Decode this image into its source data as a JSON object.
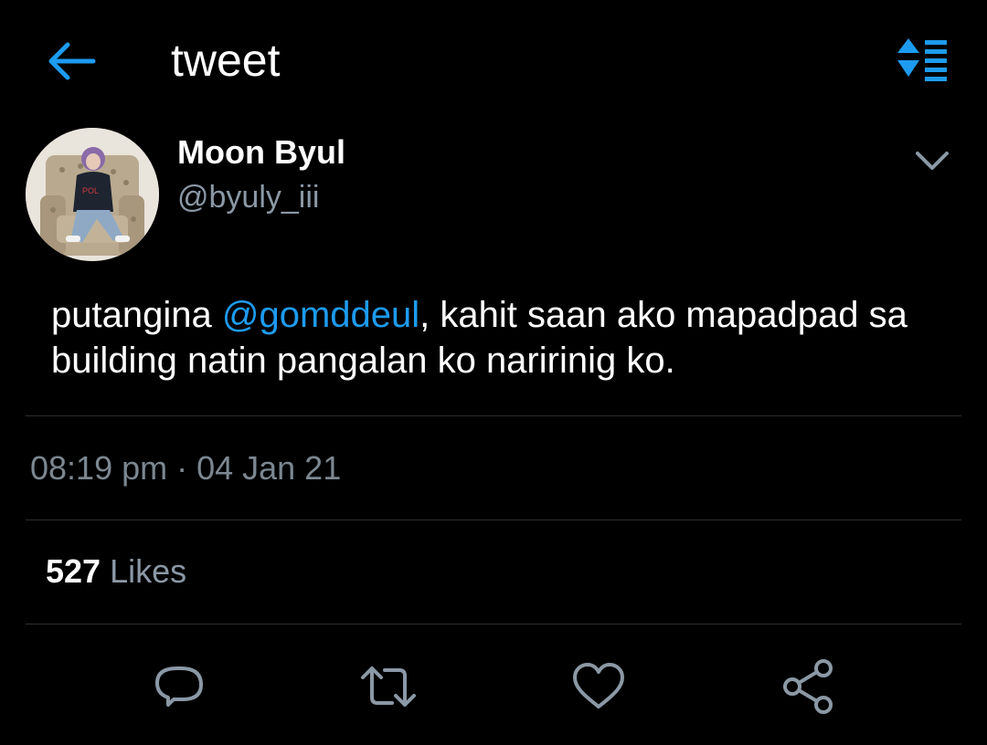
{
  "header": {
    "title": "tweet",
    "back_icon": "arrow-left-icon",
    "sort_icon": "sort-list-icon",
    "accent_color": "#1d9bf0"
  },
  "tweet": {
    "author": {
      "display_name": "Moon Byul",
      "handle": "@byuly_iii",
      "avatar": "avatar-photo"
    },
    "text_parts": {
      "before_mention": "putangina ",
      "mention": "@gomddeul",
      "after_mention": ", kahit saan ako mapadpad sa building natin pangalan ko naririnig ko."
    },
    "timestamp": "08:19 pm · 04 Jan 21",
    "likes": {
      "count": "527",
      "label": " Likes"
    }
  },
  "actions": [
    {
      "icon": "reply-icon"
    },
    {
      "icon": "retweet-icon"
    },
    {
      "icon": "like-heart-icon"
    },
    {
      "icon": "share-icon"
    }
  ],
  "colors": {
    "background": "#000000",
    "text_primary": "#ffffff",
    "text_secondary": "#8b98a5",
    "divider": "#2a2f33",
    "icon_gray": "#8b98a5",
    "mention": "#1d9bf0"
  }
}
